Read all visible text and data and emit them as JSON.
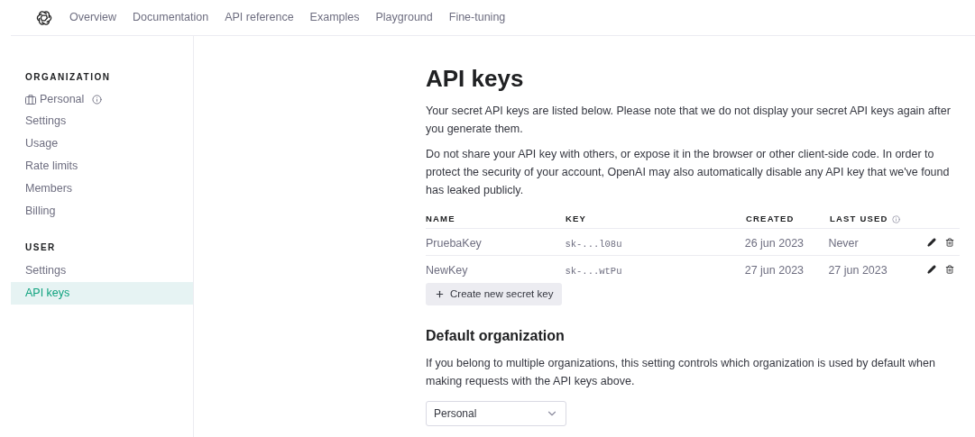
{
  "nav": [
    {
      "label": "Overview"
    },
    {
      "label": "Documentation"
    },
    {
      "label": "API reference"
    },
    {
      "label": "Examples"
    },
    {
      "label": "Playground"
    },
    {
      "label": "Fine-tuning"
    }
  ],
  "sidebar": {
    "sections": [
      {
        "heading": "ORGANIZATION",
        "org": "Personal",
        "items": [
          {
            "label": "Settings",
            "selected": false
          },
          {
            "label": "Usage",
            "selected": false
          },
          {
            "label": "Rate limits",
            "selected": false
          },
          {
            "label": "Members",
            "selected": false
          },
          {
            "label": "Billing",
            "selected": false
          }
        ]
      },
      {
        "heading": "USER",
        "items": [
          {
            "label": "Settings",
            "selected": false
          },
          {
            "label": "API keys",
            "selected": true
          }
        ]
      }
    ]
  },
  "title": "API keys",
  "paragraphs": [
    "Your secret API keys are listed below. Please note that we do not display your secret API keys again after you generate them.",
    "Do not share your API key with others, or expose it in the browser or other client-side code. In order to protect the security of your account, OpenAI may also automatically disable any API key that we've found has leaked publicly."
  ],
  "table": {
    "columns": [
      "NAME",
      "KEY",
      "CREATED",
      "LAST USED"
    ],
    "rows": [
      {
        "name": "PruebaKey",
        "key": "sk-...l08u",
        "created": "26 jun 2023",
        "last_used": "Never"
      },
      {
        "name": "NewKey",
        "key": "sk-...wtPu",
        "created": "27 jun 2023",
        "last_used": "27 jun 2023"
      }
    ]
  },
  "create_button": "Create new secret key",
  "default_org": {
    "heading": "Default organization",
    "text": "If you belong to multiple organizations, this setting controls which organization is used by default when making requests with the API keys above.",
    "value": "Personal"
  }
}
